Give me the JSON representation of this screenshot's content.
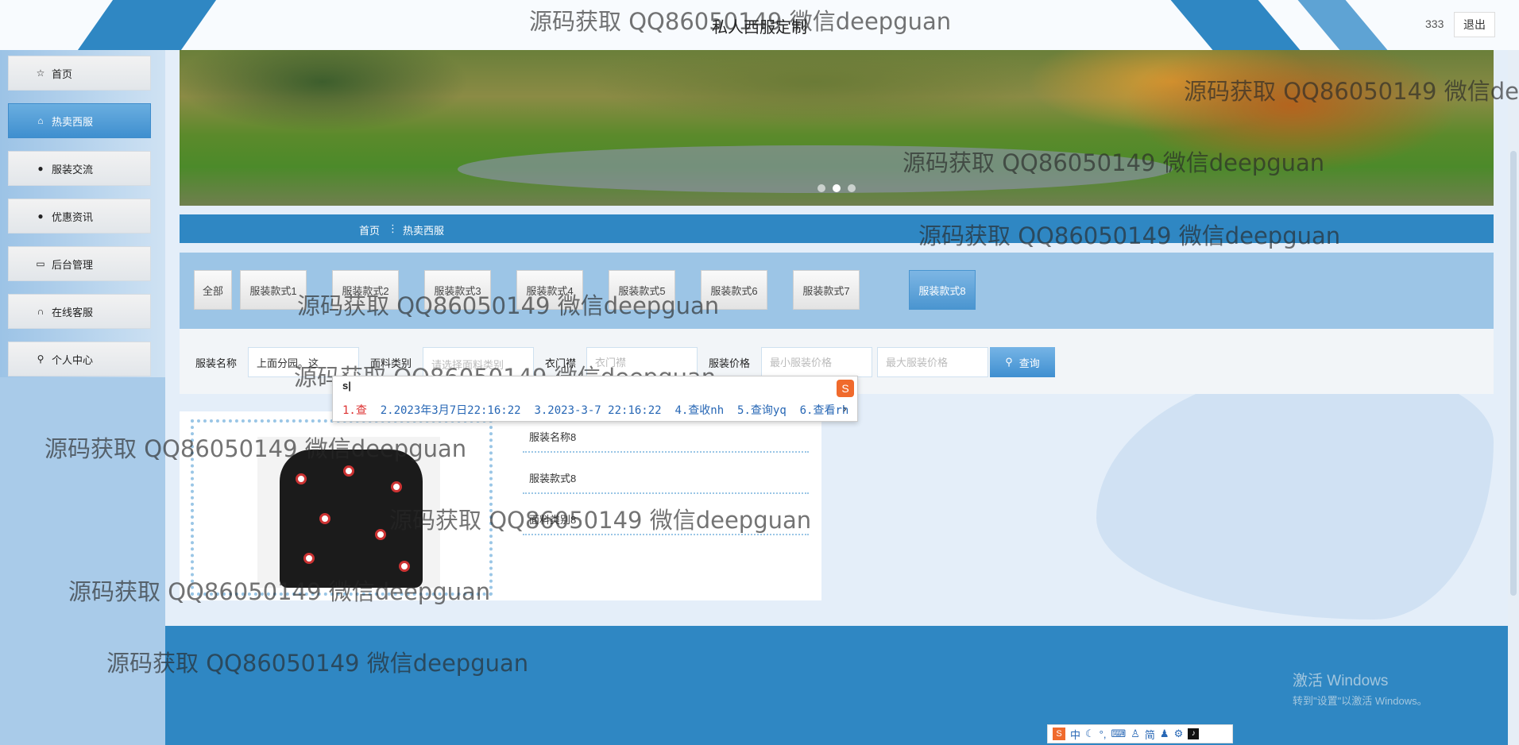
{
  "header": {
    "site_title": "私人西服定制",
    "user_name": "333",
    "logout_label": "退出"
  },
  "sidebar": {
    "items": [
      {
        "label": "首页",
        "icon": "star-icon"
      },
      {
        "label": "热卖西服",
        "icon": "bag-icon",
        "active": true
      },
      {
        "label": "服装交流",
        "icon": "alert-icon"
      },
      {
        "label": "优惠资讯",
        "icon": "question-icon"
      },
      {
        "label": "后台管理",
        "icon": "briefcase-icon"
      },
      {
        "label": "在线客服",
        "icon": "headset-icon"
      },
      {
        "label": "个人中心",
        "icon": "user-icon"
      }
    ]
  },
  "banner": {
    "slide_count": 3,
    "active_slide": 2
  },
  "breadcrumb": {
    "home": "首页",
    "separator": "⋮",
    "current": "热卖西服"
  },
  "category_tabs": {
    "items": [
      "全部",
      "服装款式1",
      "服装款式2",
      "服装款式3",
      "服装款式4",
      "服装款式5",
      "服装款式6",
      "服装款式7",
      "服装款式8"
    ],
    "active_index": 8
  },
  "search": {
    "name_label": "服装名称",
    "name_value": "上面分园。这",
    "fabric_label": "面料类别",
    "fabric_placeholder": "请选择面料类别",
    "placket_label": "衣门襟",
    "placket_placeholder": "衣门襟",
    "price_label": "服装价格",
    "min_price_placeholder": "最小服装价格",
    "max_price_placeholder": "最大服装价格",
    "query_label": "查询"
  },
  "product": {
    "name": "服装名称8",
    "style": "服装款式8",
    "fabric": "面料类别8"
  },
  "ime": {
    "composition": "s|",
    "candidates": [
      "1.查",
      "2.2023年3月7日22:16:22",
      "3.2023-3-7 22:16:22",
      "4.查收nh",
      "5.查询yq",
      "6.查看rh"
    ],
    "toolbar": [
      "中",
      "简"
    ]
  },
  "watermark": {
    "text": "源码获取 QQ86050149 微信deepguan",
    "partial_text": "源码获取 QQ86050149 微信de"
  },
  "windows_activation": {
    "title": "激活 Windows",
    "subtitle": "转到\"设置\"以激活 Windows。"
  },
  "colors": {
    "primary_blue": "#2f87c3",
    "tab_bar": "#9cc5e6",
    "page_bg": "#e4eef9",
    "active_tab": "#4a95d0"
  }
}
